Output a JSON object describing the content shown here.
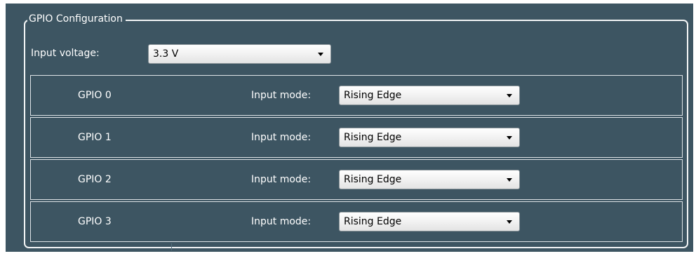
{
  "group": {
    "title": "GPIO Configuration"
  },
  "voltage": {
    "label": "Input voltage:",
    "selected": "3.3  V"
  },
  "gpios": [
    {
      "name": "GPIO 0",
      "mode_label": "Input mode:",
      "mode_value": "Rising Edge"
    },
    {
      "name": "GPIO 1",
      "mode_label": "Input mode:",
      "mode_value": "Rising Edge"
    },
    {
      "name": "GPIO 2",
      "mode_label": "Input mode:",
      "mode_value": "Rising Edge"
    },
    {
      "name": "GPIO 3",
      "mode_label": "Input mode:",
      "mode_value": "Rising Edge"
    }
  ],
  "icons": {
    "dropdown": "chevron-down-icon"
  },
  "colors": {
    "panel_background": "#3d5562",
    "border": "#f2f4f5",
    "text": "#ffffff"
  }
}
